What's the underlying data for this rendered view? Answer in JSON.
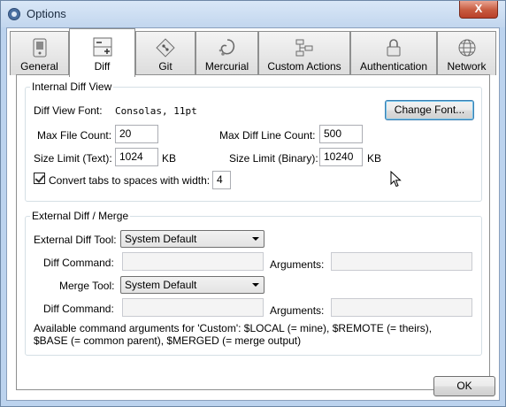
{
  "window": {
    "title": "Options",
    "close_label": "X"
  },
  "tabs": [
    {
      "label": "General",
      "icon": "phone-icon"
    },
    {
      "label": "Diff",
      "icon": "diff-icon"
    },
    {
      "label": "Git",
      "icon": "git-icon"
    },
    {
      "label": "Mercurial",
      "icon": "mercurial-icon"
    },
    {
      "label": "Custom Actions",
      "icon": "custom-actions-icon"
    },
    {
      "label": "Authentication",
      "icon": "lock-icon"
    },
    {
      "label": "Network",
      "icon": "globe-icon"
    }
  ],
  "internal": {
    "title": "Internal Diff View",
    "font_label": "Diff View Font:",
    "font_value": "Consolas, 11pt",
    "change_font_button": "Change Font...",
    "max_file_count_label": "Max File Count:",
    "max_file_count_value": "20",
    "max_diff_line_label": "Max Diff Line Count:",
    "max_diff_line_value": "500",
    "size_text_label": "Size Limit (Text):",
    "size_text_value": "1024",
    "size_text_unit": "KB",
    "size_binary_label": "Size Limit (Binary):",
    "size_binary_value": "10240",
    "size_binary_unit": "KB",
    "tabs_label": "Convert tabs to spaces with width:",
    "tabs_checked": true,
    "tabs_width_value": "4"
  },
  "external": {
    "title": "External Diff / Merge",
    "diff_tool_label": "External Diff Tool:",
    "diff_tool_value": "System Default",
    "diff_command_label": "Diff Command:",
    "diff_command_value": "",
    "diff_args_label": "Arguments:",
    "diff_args_value": "",
    "merge_tool_label": "Merge Tool:",
    "merge_tool_value": "System Default",
    "merge_command_label": "Diff Command:",
    "merge_command_value": "",
    "merge_args_label": "Arguments:",
    "merge_args_value": "",
    "note": "Available command arguments for 'Custom': $LOCAL (= mine), $REMOTE (= theirs), $BASE (= common parent), $MERGED (= merge output)"
  },
  "footer": {
    "ok_button": "OK"
  }
}
